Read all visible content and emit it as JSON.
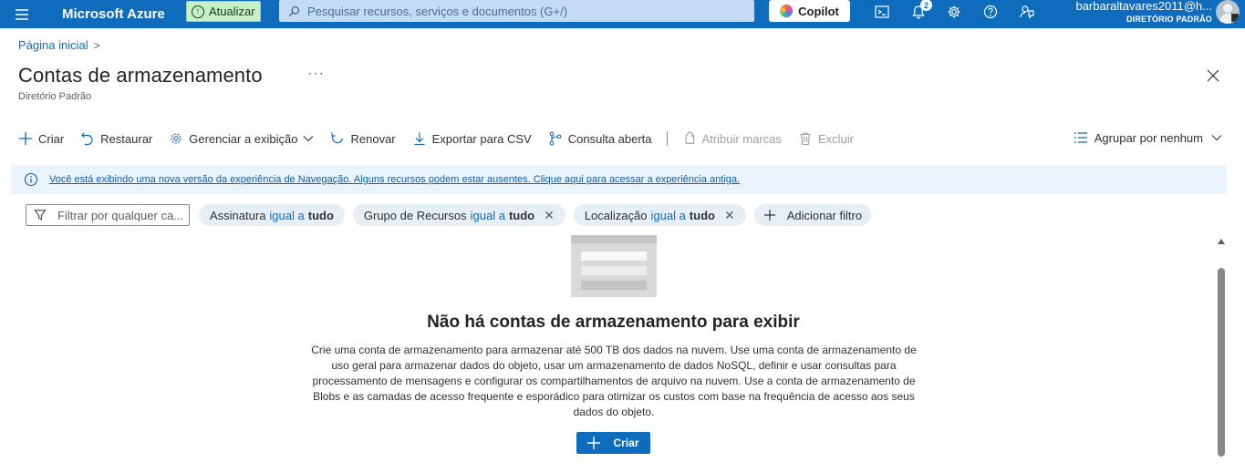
{
  "topbar": {
    "brand": "Microsoft Azure",
    "update_label": "Atualizar",
    "search_placeholder": "Pesquisar recursos, serviços e documentos (G+/)",
    "copilot_label": "Copilot",
    "notifications_count": "2",
    "account_email": "barbaraltavares2011@h...",
    "account_directory": "DIRETÓRIO PADRÃO"
  },
  "breadcrumb": {
    "home": "Página inicial",
    "separator": ">"
  },
  "page": {
    "title": "Contas de armazenamento",
    "more": "···",
    "subtitle": "Diretório Padrão"
  },
  "commands": {
    "create": "Criar",
    "restore": "Restaurar",
    "manage_view": "Gerenciar a exibição",
    "refresh": "Renovar",
    "export_csv": "Exportar para CSV",
    "open_query": "Consulta aberta",
    "assign_tags": "Atribuir marcas",
    "delete": "Excluir",
    "group_by": "Agrupar por nenhum"
  },
  "banner": {
    "text": "Você está exibindo uma nova versão da experiência de Navegação. Alguns recursos podem estar ausentes. Clique aqui para acessar a experiência antiga."
  },
  "filters": {
    "input_placeholder": "Filtrar por qualquer ca...",
    "pills": [
      {
        "field": "Assinatura",
        "op": "igual a",
        "value": "tudo"
      },
      {
        "field": "Grupo de Recursos",
        "op": "igual a",
        "value": "tudo"
      },
      {
        "field": "Localização",
        "op": "igual a",
        "value": "tudo"
      }
    ],
    "add_filter": "Adicionar filtro"
  },
  "empty_state": {
    "title": "Não há contas de armazenamento para exibir",
    "description": "Crie uma conta de armazenamento para armazenar até 500 TB dos dados na nuvem. Use uma conta de armazenamento de uso geral para armazenar dados do objeto, usar um armazenamento de dados NoSQL, definir e usar consultas para processamento de mensagens e configurar os compartilhamentos de arquivo na nuvem. Use a conta de armazenamento de Blobs e as camadas de acesso frequente e esporádico para otimizar os custos com base na frequência de acesso aos seus dados do objeto.",
    "create_button": "Criar"
  },
  "colors": {
    "accent": "#0f6cbd",
    "update_bg": "#c7f0c8",
    "banner_bg": "#ebf3fc",
    "pill_bg": "#e6eef6"
  }
}
